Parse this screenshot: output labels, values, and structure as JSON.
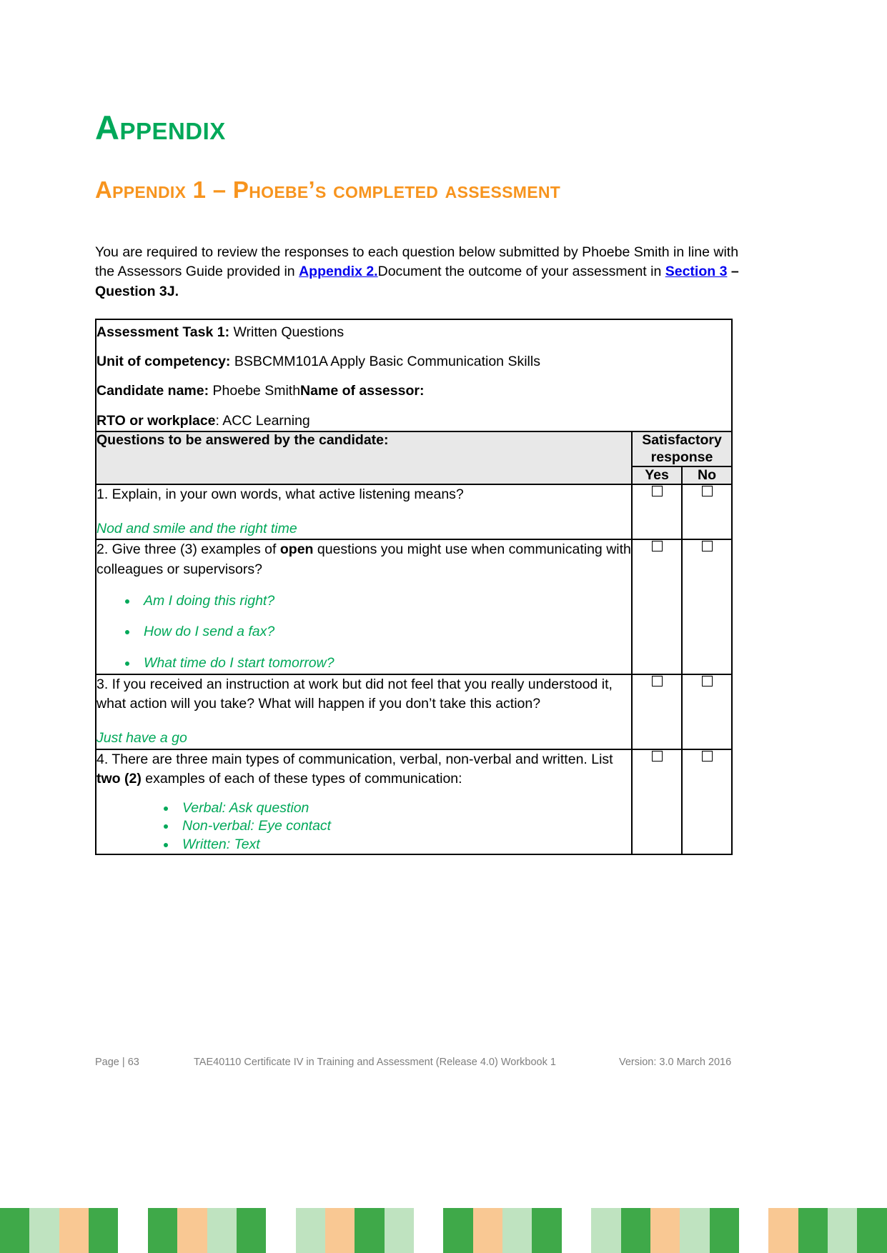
{
  "headings": {
    "title": "Appendix",
    "subtitle": "Appendix 1 – Phoebe’s completed assessment"
  },
  "intro": {
    "part1": "You are required to review the responses to each question below submitted by Phoebe Smith in line with the Assessors Guide provided in ",
    "link1": "Appendix 2.",
    "part2": "Document the outcome of your assessment in ",
    "link2": "Section 3",
    "part3": " – Question 3J."
  },
  "table_info": {
    "task_label": "Assessment Task 1:",
    "task_value": " Written Questions",
    "unit_label": "Unit of competency:",
    "unit_value": " BSBCMM101A Apply Basic Communication Skills",
    "candidate_label": "Candidate name:",
    "candidate_value": " Phoebe Smith",
    "assessor_label": "Name of assessor:",
    "rto_label": "RTO or workplace",
    "rto_value": ": ACC Learning"
  },
  "table_header": {
    "questions": "Questions to be answered by the candidate:",
    "satisfactory": "Satisfactory response",
    "yes": "Yes",
    "no": "No"
  },
  "questions": [
    {
      "number": "1.",
      "text_before": " Explain, in your own words, what active listening means?",
      "bold_word": "",
      "text_after": "",
      "answer": "Nod and smile and the right time",
      "bullets": []
    },
    {
      "number": "2.",
      "text_before": " Give three (3) examples of ",
      "bold_word": "open",
      "text_after": " questions you might use when communicating with colleagues or supervisors?",
      "answer": "",
      "bullets": [
        "Am I doing this right?",
        "How do I send a fax?",
        "What time do I start tomorrow?"
      ]
    },
    {
      "number": "3.",
      "text_before": " If you received an instruction at work but did not feel that you really understood it, what action will you take? What will happen if you don’t take this action?",
      "bold_word": "",
      "text_after": "",
      "answer": "Just have a go",
      "bullets": []
    },
    {
      "number": "4.",
      "text_before": " There are three main types of communication, verbal, non-verbal and written. List ",
      "bold_word": "two (2)",
      "text_after": " examples of each of these types of communication:",
      "answer": "",
      "bullets": [
        "Verbal: Ask question",
        "Non-verbal: Eye contact",
        "Written: Text"
      ]
    }
  ],
  "footer": {
    "page": "Page | 63",
    "middle": "TAE40110 Certificate IV in Training and Assessment (Release 4.0) Workbook 1",
    "version": "Version: 3.0 March 2016"
  },
  "colors": {
    "heading_green": "#00A859",
    "heading_orange": "#F7941E",
    "link_blue": "#0000EE",
    "answer_green": "#00A859",
    "header_grey": "#E8E8E8"
  },
  "colorbar": [
    "#3FA949",
    "#BFE3C0",
    "#F9C893",
    "#3FA949",
    "#FFFFFF",
    "#3FA949",
    "#F9C893",
    "#BFE3C0",
    "#3FA949",
    "#FFFFFF",
    "#BFE3C0",
    "#F9C893",
    "#3FA949",
    "#BFE3C0",
    "#FFFFFF",
    "#3FA949",
    "#F9C893",
    "#BFE3C0",
    "#3FA949",
    "#FFFFFF",
    "#BFE3C0",
    "#3FA949",
    "#F9C893",
    "#BFE3C0",
    "#3FA949",
    "#FFFFFF",
    "#F9C893",
    "#3FA949",
    "#BFE3C0",
    "#3FA949"
  ]
}
